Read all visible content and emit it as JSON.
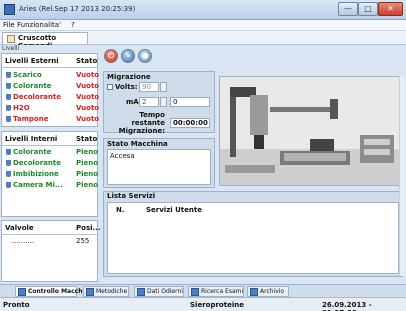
{
  "window": {
    "title": "Aries (Rel.Sep 17 2013 20:25:39)",
    "min": "—",
    "max": "□",
    "close": "✕"
  },
  "menu": {
    "items": [
      "File",
      "Funzionalita'",
      "?"
    ]
  },
  "toolbar": {
    "cruscotto_label": "Cruscotto Comandi"
  },
  "livelli_caption": "Livelli",
  "livelli_esterni": {
    "header": "Livelli Esterni",
    "state_header": "Stato",
    "rows": [
      {
        "name": "Scarico",
        "state": "Vuoto"
      },
      {
        "name": "Colorante",
        "state": "Vuoto"
      },
      {
        "name": "Decolorante",
        "state": "Vuoto"
      },
      {
        "name": "H2O",
        "state": "Vuoto"
      },
      {
        "name": "Tampone",
        "state": "Vuoto"
      }
    ]
  },
  "livelli_interni": {
    "header": "Livelli Interni",
    "state_header": "Stato",
    "rows": [
      {
        "name": "Colorante",
        "state": "Pieno"
      },
      {
        "name": "Decolorante",
        "state": "Pieno"
      },
      {
        "name": "Imbibizione",
        "state": "Pieno"
      },
      {
        "name": "Camera Mi...",
        "state": "Pieno"
      }
    ]
  },
  "valvole": {
    "header": "Valvole",
    "pos_header": "Posi...",
    "rows": [
      {
        "name": "..........",
        "pos": "255"
      }
    ]
  },
  "migrazione": {
    "title": "Migrazione",
    "volts_label": "Volts:",
    "volts_value": "90",
    "ma_label": "mA:",
    "ma_value": "2",
    "ma_text": "0",
    "tempo_label": "Tempo restante Migrazione:",
    "tempo_value": "00:00:00"
  },
  "stato_macchina": {
    "title": "Stato Macchina",
    "value": "Accesa"
  },
  "lista_servizi": {
    "title": "Lista Servizi",
    "col_n": "N.",
    "col_servizi": "Servizi Utente"
  },
  "tabs": [
    "Controllo Macchina",
    "Metodiche",
    "Dati Odierni",
    "Ricerca Esami",
    "Archivio"
  ],
  "status": {
    "left": "Pronto",
    "middle": "Sieroproteine",
    "right": "26.09.2013 - 21:37:28"
  },
  "colors": {
    "empty": "#e01b1b",
    "full": "#1d8a2a"
  }
}
